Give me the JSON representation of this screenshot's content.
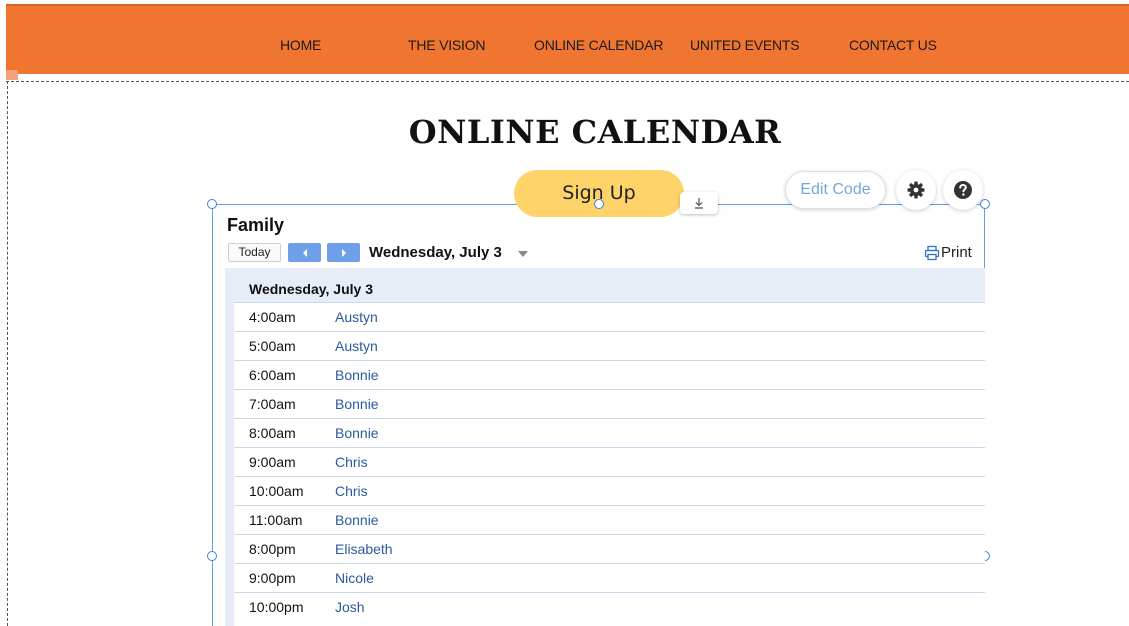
{
  "nav": {
    "items": [
      "HOME",
      "THE VISION",
      "ONLINE CALENDAR",
      "UNITED EVENTS",
      "CONTACT US"
    ]
  },
  "page": {
    "title": "ONLINE CALENDAR",
    "signup_label": "Sign Up"
  },
  "editor": {
    "edit_code_label": "Edit Code",
    "settings_icon": "gear-icon",
    "help_icon": "question-icon",
    "download_icon": "download-icon"
  },
  "calendar": {
    "title": "Family",
    "today_label": "Today",
    "current_date": "Wednesday, July 3",
    "print_label": "Print",
    "day_header": "Wednesday, July 3",
    "events": [
      {
        "time": "4:00am",
        "name": "Austyn"
      },
      {
        "time": "5:00am",
        "name": "Austyn"
      },
      {
        "time": "6:00am",
        "name": "Bonnie"
      },
      {
        "time": "7:00am",
        "name": "Bonnie"
      },
      {
        "time": "8:00am",
        "name": "Bonnie"
      },
      {
        "time": "9:00am",
        "name": "Chris"
      },
      {
        "time": "10:00am",
        "name": "Chris"
      },
      {
        "time": "11:00am",
        "name": "Bonnie"
      },
      {
        "time": "8:00pm",
        "name": "Elisabeth"
      },
      {
        "time": "9:00pm",
        "name": "Nicole"
      },
      {
        "time": "10:00pm",
        "name": "Josh"
      }
    ]
  },
  "colors": {
    "nav_bg": "#f07530",
    "signup_bg": "#fdd36a",
    "arrow_bg": "#6f9fe8",
    "event_link": "#2c5aa0",
    "agenda_bg": "#e7edf6",
    "selection": "#5aa0e0"
  }
}
